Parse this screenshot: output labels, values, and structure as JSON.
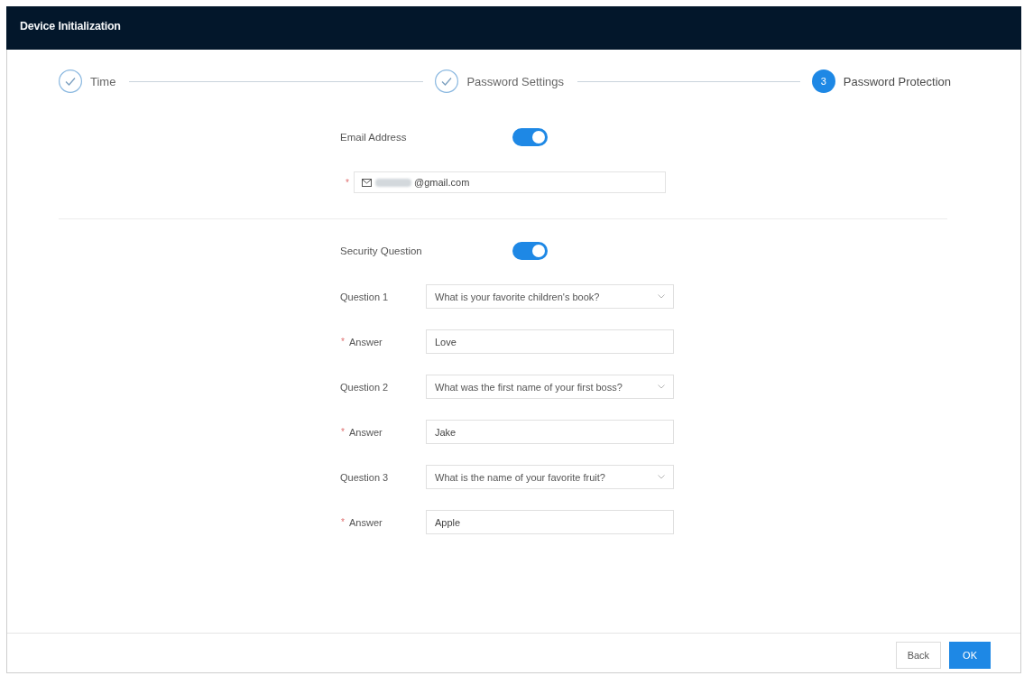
{
  "window": {
    "title": "Device Initialization"
  },
  "steps": [
    {
      "label": "Time",
      "completed": true
    },
    {
      "label": "Password Settings",
      "completed": true
    },
    {
      "label": "Password Protection",
      "completed": false,
      "number": "3"
    }
  ],
  "email": {
    "label": "Email Address",
    "enabled": true,
    "required_mark": "*",
    "redacted": true,
    "value": "@gmail.com"
  },
  "security": {
    "label": "Security Question",
    "enabled": true,
    "questions": [
      {
        "label": "Question 1",
        "question": "What is your favorite children's book?",
        "required_mark": "*",
        "answer_label": "Answer",
        "answer": "Love"
      },
      {
        "label": "Question 2",
        "question": "What was the first name of your first boss?",
        "required_mark": "*",
        "answer_label": "Answer",
        "answer": "Jake"
      },
      {
        "label": "Question 3",
        "question": "What is the name of your favorite fruit?",
        "required_mark": "*",
        "answer_label": "Answer",
        "answer": "Apple"
      }
    ]
  },
  "buttons": [
    {
      "label": "Back",
      "kind": "secondary"
    },
    {
      "label": "OK",
      "kind": "primary"
    }
  ]
}
